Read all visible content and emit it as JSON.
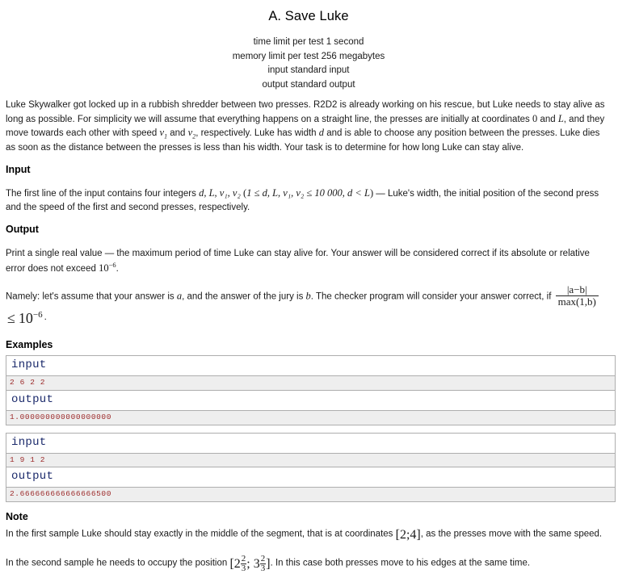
{
  "problem": {
    "title": "A. Save Luke",
    "limits": [
      "time limit per test 1 second",
      "memory limit per test 256 megabytes",
      "input standard input",
      "output standard output"
    ],
    "time_limit_label": "time limit per test",
    "time_limit_value": "1 second",
    "memory_limit_label": "memory limit per test",
    "memory_limit_value": "256 megabytes",
    "input_stream_label": "input",
    "input_stream_value": "standard input",
    "output_stream_label": "output",
    "output_stream_value": "standard output"
  },
  "legend": {
    "para1_a": "Luke Skywalker got locked up in a rubbish shredder between two presses. R2D2 is already working on his rescue, but Luke needs to stay alive as long as possible. For simplicity we will assume that everything happens on a straight line, the presses are initially at coordinates ",
    "var_zero": "0",
    "para1_b": " and ",
    "var_L": "L",
    "para1_c": ", and they move towards each other with speed ",
    "var_v1": "v",
    "var_v1_sub": "1",
    "para1_d": " and ",
    "var_v2": "v",
    "var_v2_sub": "2",
    "para1_e": ", respectively. Luke has width ",
    "var_d": "d",
    "para1_f": " and is able to choose any position between the presses. Luke dies as soon as the distance between the presses is less than his width. Your task is to determine for how long Luke can stay alive."
  },
  "input_section": {
    "heading": "Input",
    "text_a": "The first line of the input contains four integers ",
    "vars": "d, L, v₁, v₂",
    "constraint_open": "(",
    "constraint": "1 ≤ d, L, v₁, v₂ ≤ 10 000, d < L",
    "constraint_close": ")",
    "text_b": " — Luke's width, the initial position of the second press and the speed of the first and second presses, respectively."
  },
  "output_section": {
    "heading": "Output",
    "text_a": "Print a single real value — the maximum period of time Luke can stay alive for. Your answer will be considered correct if its absolute or relative error does not exceed ",
    "eps_base": "10",
    "eps_exp": "−6",
    "text_b": ".",
    "namely_a": "Namely: let's assume that your answer is ",
    "var_a": "a",
    "namely_b": ", and the answer of the jury is ",
    "var_b": "b",
    "namely_c": ". The checker program will consider your answer correct, if ",
    "frac_num": "|a−b|",
    "frac_den": "max(1,b)",
    "rel": "≤",
    "rhs_base": "10",
    "rhs_exp": "−6",
    "namely_d": "."
  },
  "samples": {
    "heading": "Examples",
    "input_label": "input",
    "output_label": "output",
    "tests": [
      {
        "input": "2 6 2 2",
        "output": "1.000000000000000000"
      },
      {
        "input": "1 9 1 2",
        "output": "2.666666666666666500"
      }
    ]
  },
  "note_section": {
    "heading": "Note",
    "note1_a": "In the first sample Luke should stay exactly in the middle of the segment, that is at coordinates ",
    "note1_interval": "[2;4]",
    "note1_b": ", as the presses move with the same speed.",
    "note2_a": "In the second sample he needs to occupy the position ",
    "note2_whole1": "2",
    "note2_num1": "2",
    "note2_den1": "3",
    "note2_sep": "; ",
    "note2_whole2": "3",
    "note2_num2": "2",
    "note2_den2": "3",
    "note2_b": ". In this case both presses move to his edges at the same time."
  },
  "colors": {
    "io_title": "#1b2a6b",
    "io_text": "#9c2a2a",
    "io_bg": "#eeeeee",
    "border": "#aeaeae",
    "body_text": "#1a1a1a"
  }
}
